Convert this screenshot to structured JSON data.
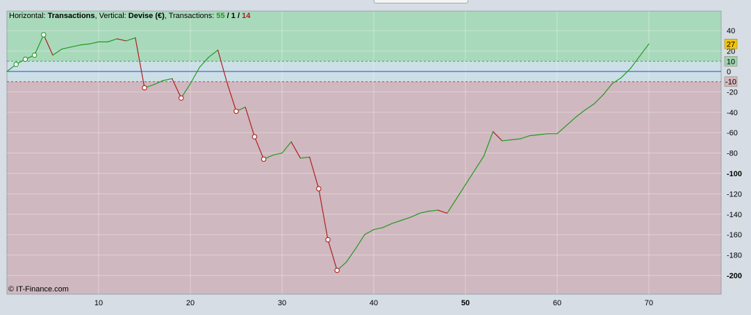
{
  "header": {
    "horizontal_prefix": "Horizontal: ",
    "horizontal_value": "Transactions",
    "vertical_prefix": ", Vertical: ",
    "vertical_value": "Devise (€)",
    "transactions_prefix": ", Transactions: ",
    "count_green": "55",
    "sep1": " / ",
    "count_neutral": "1",
    "sep2": " / ",
    "count_red": "14"
  },
  "copyright": "© IT-Finance.com",
  "colors": {
    "profit_zone": "#a9d9bb",
    "loss_zone": "#cfb8bf",
    "neutral_band": "#ccdfe6",
    "gain_line": "#1f9a1f",
    "loss_line": "#b01c1c",
    "zero_line": "#3344cc",
    "current_badge": "#f5c400",
    "upper_badge": "#9fd3b2",
    "lower_badge": "#d7b6bf"
  },
  "badges": {
    "current": "27",
    "upper": "10",
    "lower": "-10"
  },
  "chart_data": {
    "type": "line",
    "title": "",
    "xlabel": "Transactions",
    "ylabel": "Devise (€)",
    "xlim": [
      0,
      78
    ],
    "ylim": [
      -217,
      58
    ],
    "x_ticks": [
      10,
      20,
      30,
      40,
      50,
      60,
      70
    ],
    "x_tick_labels": [
      "10",
      "20",
      "30",
      "40",
      "50",
      "60",
      "70"
    ],
    "y_ticks": [
      40,
      20,
      0,
      -20,
      -40,
      -60,
      -80,
      -100,
      -120,
      -140,
      -160,
      -180,
      -200
    ],
    "y_tick_labels": [
      "40",
      "20",
      "0",
      "-20",
      "-40",
      "-60",
      "-80",
      "-100",
      "-120",
      "-140",
      "-160",
      "-180",
      "-200"
    ],
    "profit_threshold": 10,
    "loss_threshold": -10,
    "grid": true,
    "points": [
      [
        0,
        0
      ],
      [
        1,
        7
      ],
      [
        2,
        12
      ],
      [
        3,
        16
      ],
      [
        4,
        36
      ],
      [
        5,
        16
      ],
      [
        6,
        22
      ],
      [
        7,
        24
      ],
      [
        8,
        26
      ],
      [
        9,
        27
      ],
      [
        10,
        29
      ],
      [
        11,
        29
      ],
      [
        12,
        32
      ],
      [
        13,
        30
      ],
      [
        14,
        33
      ],
      [
        15,
        -16
      ],
      [
        16,
        -13
      ],
      [
        17,
        -9
      ],
      [
        18,
        -7
      ],
      [
        19,
        -26
      ],
      [
        20,
        -12
      ],
      [
        21,
        4
      ],
      [
        22,
        14
      ],
      [
        23,
        21
      ],
      [
        24,
        -11
      ],
      [
        25,
        -39
      ],
      [
        26,
        -35
      ],
      [
        27,
        -64
      ],
      [
        28,
        -86
      ],
      [
        29,
        -82
      ],
      [
        30,
        -80
      ],
      [
        31,
        -69
      ],
      [
        32,
        -85
      ],
      [
        33,
        -84
      ],
      [
        34,
        -115
      ],
      [
        35,
        -165
      ],
      [
        36,
        -195
      ],
      [
        37,
        -187
      ],
      [
        38,
        -174
      ],
      [
        39,
        -160
      ],
      [
        40,
        -155
      ],
      [
        41,
        -153
      ],
      [
        42,
        -149
      ],
      [
        43,
        -146
      ],
      [
        44,
        -143
      ],
      [
        45,
        -139
      ],
      [
        46,
        -137
      ],
      [
        47,
        -136
      ],
      [
        48,
        -139
      ],
      [
        49,
        -125
      ],
      [
        50,
        -111
      ],
      [
        51,
        -97
      ],
      [
        52,
        -83
      ],
      [
        53,
        -59
      ],
      [
        54,
        -68
      ],
      [
        55,
        -67
      ],
      [
        56,
        -66
      ],
      [
        57,
        -63
      ],
      [
        58,
        -62
      ],
      [
        59,
        -61
      ],
      [
        60,
        -61
      ],
      [
        61,
        -53
      ],
      [
        62,
        -45
      ],
      [
        63,
        -38
      ],
      [
        64,
        -32
      ],
      [
        65,
        -23
      ],
      [
        66,
        -12
      ],
      [
        67,
        -6
      ],
      [
        68,
        3
      ],
      [
        69,
        15
      ],
      [
        70,
        27
      ]
    ],
    "loss_markers": [
      15,
      19,
      25,
      27,
      28,
      34,
      35,
      36
    ],
    "gain_markers": [
      1,
      2,
      3,
      4
    ]
  }
}
